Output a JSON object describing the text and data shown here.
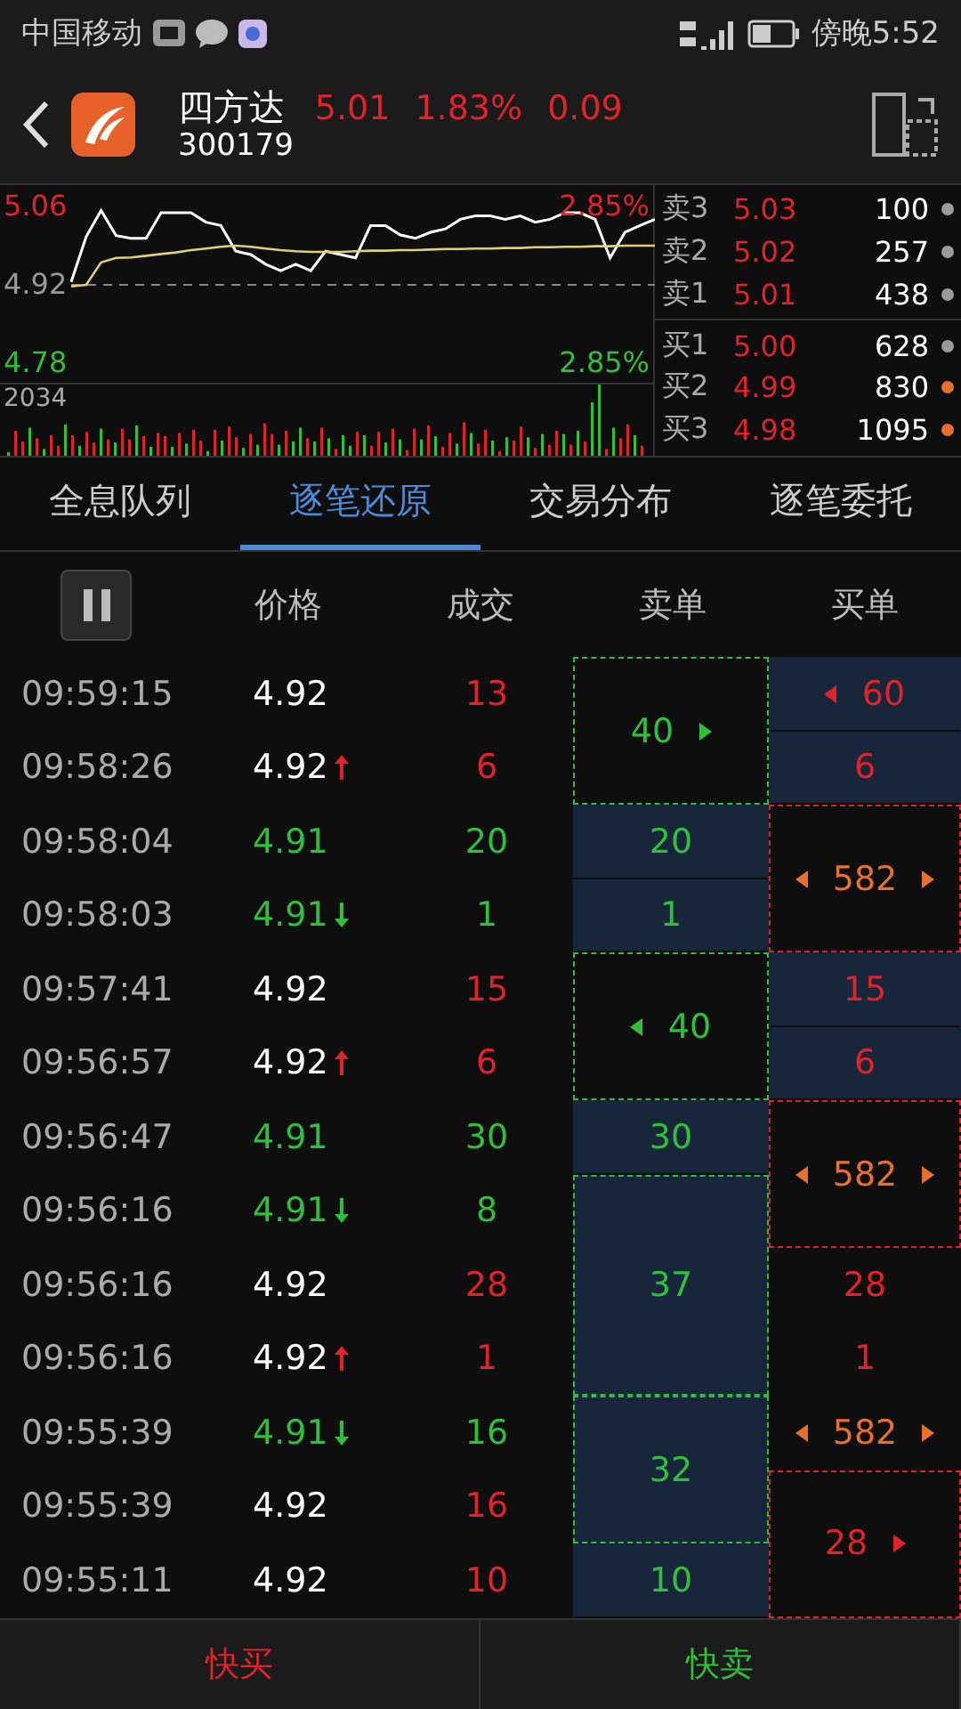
{
  "status_bar": {
    "carrier": "中国移动",
    "time": "傍晚5:52"
  },
  "header": {
    "name": "四方达",
    "code": "300179",
    "price": "5.01",
    "percent": "1.83%",
    "change": "0.09"
  },
  "chart": {
    "high_pct": "2.85%",
    "low_pct": "2.85%",
    "volume_max": "2034",
    "chart_data": {
      "type": "line",
      "ylim": [
        4.78,
        5.06
      ],
      "yticks": [
        {
          "value": 5.06,
          "label": "5.06"
        },
        {
          "value": 4.92,
          "label": "4.92"
        },
        {
          "value": 4.78,
          "label": "4.78"
        }
      ],
      "series": [
        {
          "color": "#ffffff",
          "values": [
            4.925,
            5.006,
            5.053,
            5.008,
            5.003,
            5.003,
            5.049,
            5.049,
            5.049,
            5.032,
            5.026,
            4.98,
            4.974,
            4.957,
            4.945,
            4.957,
            4.945,
            4.98,
            4.974,
            4.968,
            5.026,
            5.026,
            5.009,
            5.003,
            5.014,
            5.02,
            5.037,
            5.043,
            5.043,
            5.037,
            5.043,
            5.032,
            5.037,
            5.049,
            5.049,
            5.037,
            4.968,
            5.014,
            5.026,
            5.037
          ]
        },
        {
          "color": "#e0d070",
          "values": [
            4.917,
            4.92,
            4.96,
            4.968,
            4.969,
            4.972,
            4.975,
            4.978,
            4.982,
            4.985,
            4.988,
            4.99,
            4.988,
            4.985,
            4.982,
            4.98,
            4.979,
            4.979,
            4.979,
            4.98,
            4.981,
            4.981,
            4.982,
            4.982,
            4.983,
            4.984,
            4.984,
            4.985,
            4.985,
            4.986,
            4.986,
            4.987,
            4.987,
            4.988,
            4.988,
            4.989,
            4.989,
            4.99,
            4.99,
            4.99
          ]
        }
      ]
    }
  },
  "order_book": {
    "asks": [
      {
        "label": "卖3",
        "price": "5.03",
        "volume": "100",
        "color": "#9a9a9a"
      },
      {
        "label": "卖2",
        "price": "5.02",
        "volume": "257",
        "color": "#9a9a9a"
      },
      {
        "label": "卖1",
        "price": "5.01",
        "volume": "438",
        "color": "#9a9a9a"
      }
    ],
    "bids": [
      {
        "label": "买1",
        "price": "5.00",
        "volume": "628",
        "color": "#9a9a9a"
      },
      {
        "label": "买2",
        "price": "4.99",
        "volume": "830",
        "color": "#e8702a"
      },
      {
        "label": "买3",
        "price": "4.98",
        "volume": "1095",
        "color": "#e8702a"
      }
    ]
  },
  "tabs": [
    {
      "label": "全息队列",
      "selected": false
    },
    {
      "label": "逐笔还原",
      "selected": true
    },
    {
      "label": "交易分布",
      "selected": false
    },
    {
      "label": "逐笔委托",
      "selected": false
    }
  ],
  "columns": [
    "价格",
    "成交",
    "卖单",
    "买单"
  ],
  "trades": [
    {
      "time": "09:59:15",
      "price": "4.92",
      "buy": true,
      "up_arrow": false,
      "down_arrow": false,
      "volume": "13"
    },
    {
      "time": "09:58:26",
      "price": "4.92",
      "buy": true,
      "up_arrow": true,
      "down_arrow": false,
      "volume": "6"
    },
    {
      "time": "09:58:04",
      "price": "4.91",
      "buy": false,
      "up_arrow": false,
      "down_arrow": false,
      "volume": "20"
    },
    {
      "time": "09:58:03",
      "price": "4.91",
      "buy": false,
      "up_arrow": false,
      "down_arrow": true,
      "volume": "1"
    },
    {
      "time": "09:57:41",
      "price": "4.92",
      "buy": true,
      "up_arrow": false,
      "down_arrow": false,
      "volume": "15"
    },
    {
      "time": "09:56:57",
      "price": "4.92",
      "buy": true,
      "up_arrow": true,
      "down_arrow": false,
      "volume": "6"
    },
    {
      "time": "09:56:47",
      "price": "4.91",
      "buy": false,
      "up_arrow": false,
      "down_arrow": false,
      "volume": "30"
    },
    {
      "time": "09:56:16",
      "price": "4.91",
      "buy": false,
      "up_arrow": false,
      "down_arrow": true,
      "volume": "8"
    },
    {
      "time": "09:56:16",
      "price": "4.92",
      "buy": true,
      "up_arrow": false,
      "down_arrow": false,
      "volume": "28"
    },
    {
      "time": "09:56:16",
      "price": "4.92",
      "buy": true,
      "up_arrow": true,
      "down_arrow": false,
      "volume": "1"
    },
    {
      "time": "09:55:39",
      "price": "4.91",
      "buy": false,
      "up_arrow": false,
      "down_arrow": true,
      "volume": "16"
    },
    {
      "time": "09:55:39",
      "price": "4.92",
      "buy": true,
      "up_arrow": false,
      "down_arrow": false,
      "volume": "16"
    },
    {
      "time": "09:55:11",
      "price": "4.92",
      "buy": true,
      "up_arrow": false,
      "down_arrow": false,
      "volume": "10"
    }
  ],
  "sell_orders": [
    {
      "volume": "40",
      "kind": "double",
      "outlined": true,
      "filled": false,
      "left_arrow": false,
      "right_arrow": true
    },
    {
      "volume": "20",
      "kind": "single",
      "outlined": false,
      "filled": true,
      "left_arrow": false,
      "right_arrow": false
    },
    {
      "volume": "1",
      "kind": "single",
      "outlined": false,
      "filled": true,
      "left_arrow": false,
      "right_arrow": false
    },
    {
      "volume": "40",
      "kind": "double",
      "outlined": true,
      "filled": false,
      "left_arrow": true,
      "right_arrow": false
    },
    {
      "volume": "30",
      "kind": "single",
      "outlined": false,
      "filled": true,
      "left_arrow": false,
      "right_arrow": false
    },
    {
      "volume": "37",
      "kind": "triple",
      "outlined": true,
      "filled": true,
      "left_arrow": false,
      "right_arrow": false
    },
    {
      "volume": "32",
      "kind": "double",
      "outlined": true,
      "filled": true,
      "left_arrow": false,
      "right_arrow": false
    },
    {
      "volume": "10",
      "kind": "single",
      "outlined": false,
      "filled": true,
      "left_arrow": false,
      "right_arrow": false
    }
  ],
  "buy_orders": [
    {
      "volume": "60",
      "kind": "single",
      "outlined": false,
      "filled": true,
      "left_arrow": true,
      "right_arrow": false,
      "color": "#e0222a"
    },
    {
      "volume": "6",
      "kind": "single",
      "outlined": false,
      "filled": true,
      "left_arrow": false,
      "right_arrow": false,
      "color": "#e0222a"
    },
    {
      "volume": "582",
      "kind": "double",
      "outlined": true,
      "filled": false,
      "left_arrow": true,
      "right_arrow": true,
      "color": "#e8702a"
    },
    {
      "volume": "15",
      "kind": "single",
      "outlined": false,
      "filled": true,
      "left_arrow": false,
      "right_arrow": false,
      "color": "#e0222a"
    },
    {
      "volume": "6",
      "kind": "single",
      "outlined": false,
      "filled": true,
      "left_arrow": false,
      "right_arrow": false,
      "color": "#e0222a"
    },
    {
      "volume": "582",
      "kind": "double",
      "outlined": true,
      "filled": false,
      "left_arrow": true,
      "right_arrow": true,
      "color": "#e8702a"
    },
    {
      "volume": "28",
      "kind": "single",
      "outlined": false,
      "filled": false,
      "left_arrow": false,
      "right_arrow": false,
      "color": "#e0222a"
    },
    {
      "volume": "1",
      "kind": "single",
      "outlined": false,
      "filled": false,
      "left_arrow": false,
      "right_arrow": false,
      "color": "#e0222a"
    },
    {
      "volume": "582",
      "kind": "single",
      "outlined": false,
      "filled": false,
      "left_arrow": true,
      "right_arrow": true,
      "color": "#e8702a"
    },
    {
      "volume": "28",
      "kind": "double",
      "outlined": true,
      "filled": false,
      "left_arrow": false,
      "right_arrow": true,
      "color": "#e0222a"
    }
  ],
  "bottom": {
    "buy": "快买",
    "sell": "快卖"
  }
}
